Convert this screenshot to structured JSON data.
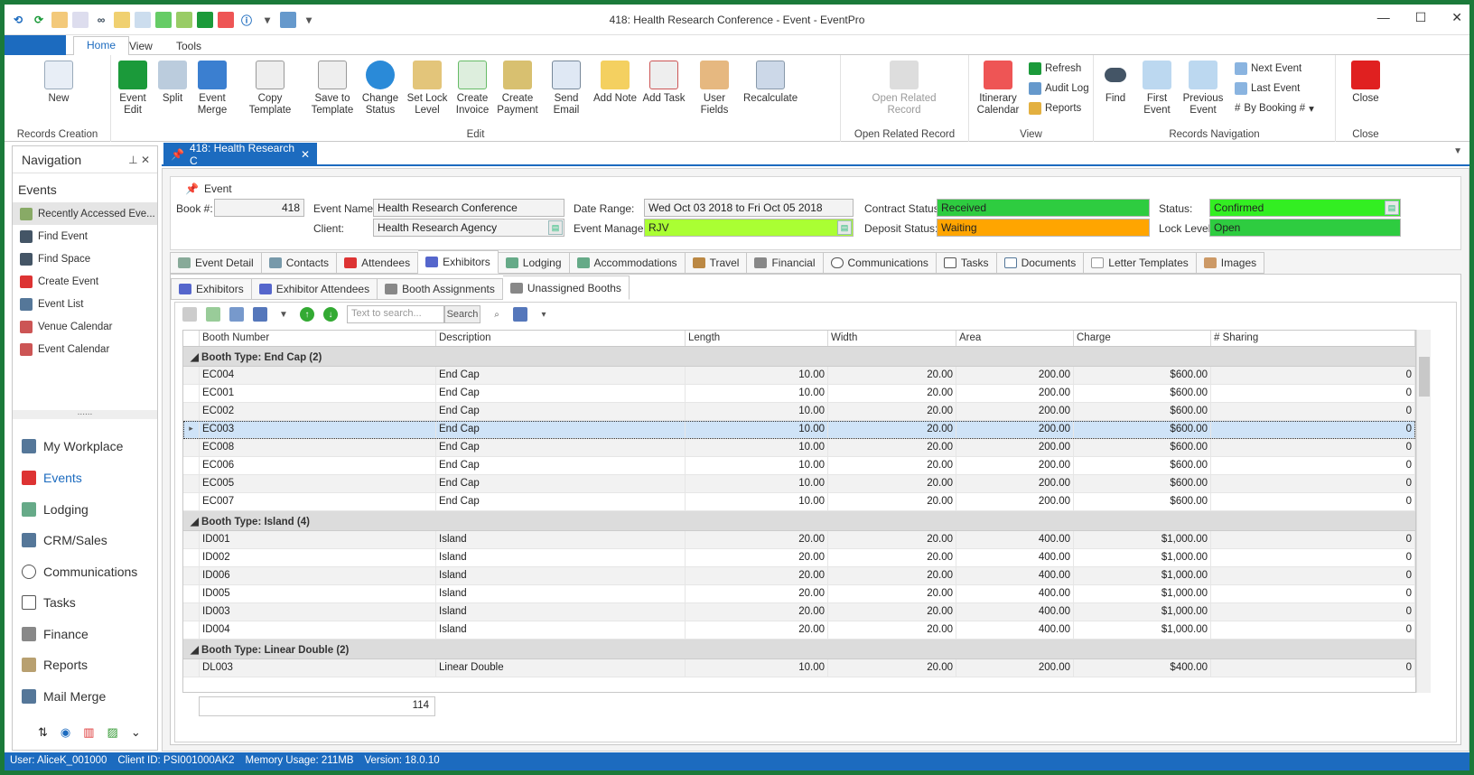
{
  "window": {
    "title": "418: Health Research Conference - Event - EventPro"
  },
  "ribbon_tabs": [
    "Home",
    "View",
    "Tools"
  ],
  "ribbon": {
    "new": "New",
    "records_creation": "Records Creation",
    "event_edit": "Event Edit",
    "split": "Split",
    "event_merge": "Event Merge",
    "copy_template": "Copy Template",
    "save_to_template": "Save to Template",
    "change_status": "Change Status",
    "set_lock_level": "Set Lock Level",
    "create_invoice": "Create Invoice",
    "create_payment": "Create Payment",
    "send_email": "Send Email",
    "add_note": "Add Note",
    "add_task": "Add Task",
    "user_fields": "User Fields",
    "recalculate": "Recalculate",
    "edit_group": "Edit",
    "open_related_record": "Open Related Record",
    "open_related_group": "Open Related Record",
    "itinerary_calendar": "Itinerary Calendar",
    "refresh": "Refresh",
    "audit_log": "Audit Log",
    "reports": "Reports",
    "view_group": "View",
    "find": "Find",
    "first_event": "First Event",
    "previous_event": "Previous Event",
    "next_event": "Next Event",
    "last_event": "Last Event",
    "by_booking": "By Booking #",
    "records_nav_group": "Records Navigation",
    "close": "Close",
    "close_group": "Close"
  },
  "nav": {
    "title": "Navigation",
    "section": "Events",
    "items": [
      "Recently Accessed Eve...",
      "Find Event",
      "Find Space",
      "Create Event",
      "Event List",
      "Venue Calendar",
      "Event Calendar"
    ],
    "bottom": [
      "My Workplace",
      "Events",
      "Lodging",
      "CRM/Sales",
      "Communications",
      "Tasks",
      "Finance",
      "Reports",
      "Mail Merge"
    ],
    "divider": "......"
  },
  "doc_tab": "418: Health Research C",
  "event": {
    "group_title": "Event",
    "book_label": "Book #:",
    "book_value": "418",
    "name_label": "Event Name:",
    "name_value": "Health Research Conference",
    "client_label": "Client:",
    "client_value": "Health Research Agency",
    "date_label": "Date Range:",
    "date_value": "Wed Oct 03 2018 to Fri Oct 05 2018",
    "manager_label": "Event Manager:",
    "manager_value": "RJV",
    "contract_label": "Contract Status:",
    "contract_value": "Received",
    "deposit_label": "Deposit Status:",
    "deposit_value": "Waiting",
    "status_label": "Status:",
    "status_value": "Confirmed",
    "lock_label": "Lock Level:",
    "lock_value": "Open"
  },
  "main_tabs": [
    "Event Detail",
    "Contacts",
    "Attendees",
    "Exhibitors",
    "Lodging",
    "Accommodations",
    "Travel",
    "Financial",
    "Communications",
    "Tasks",
    "Documents",
    "Letter Templates",
    "Images"
  ],
  "sub_tabs": [
    "Exhibitors",
    "Exhibitor Attendees",
    "Booth Assignments",
    "Unassigned Booths"
  ],
  "toolbar": {
    "search_placeholder": "Text to search...",
    "search_button": "Search"
  },
  "grid": {
    "columns": [
      "Booth Number",
      "Description",
      "Length",
      "Width",
      "Area",
      "Charge",
      "# Sharing"
    ],
    "groups": [
      {
        "title": "Booth Type: End Cap (2)",
        "rows": [
          [
            "EC004",
            "End Cap",
            "10.00",
            "20.00",
            "200.00",
            "$600.00",
            "0"
          ],
          [
            "EC001",
            "End Cap",
            "10.00",
            "20.00",
            "200.00",
            "$600.00",
            "0"
          ],
          [
            "EC002",
            "End Cap",
            "10.00",
            "20.00",
            "200.00",
            "$600.00",
            "0"
          ],
          [
            "EC003",
            "End Cap",
            "10.00",
            "20.00",
            "200.00",
            "$600.00",
            "0"
          ],
          [
            "EC008",
            "End Cap",
            "10.00",
            "20.00",
            "200.00",
            "$600.00",
            "0"
          ],
          [
            "EC006",
            "End Cap",
            "10.00",
            "20.00",
            "200.00",
            "$600.00",
            "0"
          ],
          [
            "EC005",
            "End Cap",
            "10.00",
            "20.00",
            "200.00",
            "$600.00",
            "0"
          ],
          [
            "EC007",
            "End Cap",
            "10.00",
            "20.00",
            "200.00",
            "$600.00",
            "0"
          ]
        ]
      },
      {
        "title": "Booth Type: Island (4)",
        "rows": [
          [
            "ID001",
            "Island",
            "20.00",
            "20.00",
            "400.00",
            "$1,000.00",
            "0"
          ],
          [
            "ID002",
            "Island",
            "20.00",
            "20.00",
            "400.00",
            "$1,000.00",
            "0"
          ],
          [
            "ID006",
            "Island",
            "20.00",
            "20.00",
            "400.00",
            "$1,000.00",
            "0"
          ],
          [
            "ID005",
            "Island",
            "20.00",
            "20.00",
            "400.00",
            "$1,000.00",
            "0"
          ],
          [
            "ID003",
            "Island",
            "20.00",
            "20.00",
            "400.00",
            "$1,000.00",
            "0"
          ],
          [
            "ID004",
            "Island",
            "20.00",
            "20.00",
            "400.00",
            "$1,000.00",
            "0"
          ]
        ]
      },
      {
        "title": "Booth Type: Linear Double (2)",
        "rows": [
          [
            "DL003",
            "Linear Double",
            "10.00",
            "20.00",
            "200.00",
            "$400.00",
            "0"
          ]
        ]
      }
    ],
    "selected_booth": "EC003",
    "footer_count": "114"
  },
  "statusbar": {
    "user": "User: AliceK_001000",
    "client": "Client ID: PSI001000AK2",
    "memory": "Memory Usage: 211MB",
    "version": "Version: 18.0.10"
  },
  "colors": {
    "accent": "#1c6bbf",
    "received": "#2ecc40",
    "waiting": "#ffa500",
    "confirmed": "#33ee22",
    "manager": "#aaff33",
    "open": "#2ecc40"
  }
}
